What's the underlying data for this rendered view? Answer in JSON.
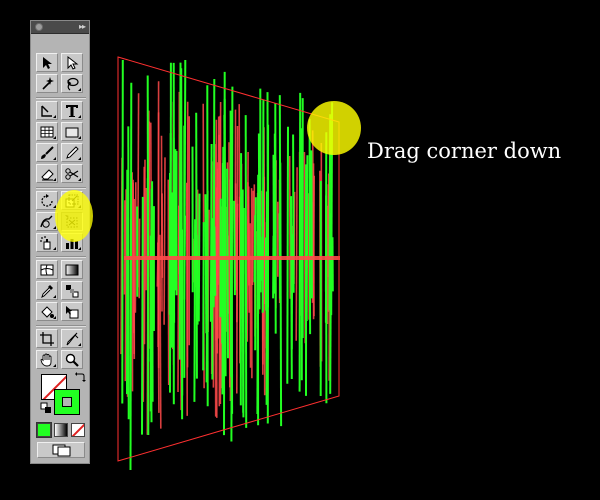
{
  "instruction": {
    "text": "Drag corner down"
  },
  "colors": {
    "background": "#000000",
    "stroke_primary": "#22ff22",
    "stroke_secondary": "#ff4a4a",
    "bounding_box": "#ff3030",
    "highlight": "#ffff00",
    "fill_indicator": "#ffffff",
    "stroke_indicator": "#22ff22"
  },
  "toolbar": {
    "tools": [
      {
        "name": "selection-tool-icon"
      },
      {
        "name": "direct-selection-tool-icon"
      },
      {
        "name": "magic-wand-tool-icon"
      },
      {
        "name": "lasso-tool-icon"
      },
      {
        "name": "pen-tool-icon"
      },
      {
        "name": "type-tool-icon"
      },
      {
        "name": "line-segment-tool-icon"
      },
      {
        "name": "rectangle-tool-icon"
      },
      {
        "name": "paintbrush-tool-icon"
      },
      {
        "name": "pencil-tool-icon"
      },
      {
        "name": "eraser-tool-icon"
      },
      {
        "name": "scissors-tool-icon"
      },
      {
        "name": "rotate-tool-icon"
      },
      {
        "name": "scale-tool-icon"
      },
      {
        "name": "warp-tool-icon"
      },
      {
        "name": "free-transform-tool-icon"
      },
      {
        "name": "symbol-sprayer-tool-icon"
      },
      {
        "name": "column-graph-tool-icon"
      },
      {
        "name": "mesh-tool-icon"
      },
      {
        "name": "gradient-tool-icon"
      },
      {
        "name": "eyedropper-tool-icon"
      },
      {
        "name": "blend-tool-icon"
      },
      {
        "name": "live-paint-bucket-tool-icon"
      },
      {
        "name": "live-paint-selection-tool-icon"
      },
      {
        "name": "crop-area-tool-icon"
      },
      {
        "name": "slice-tool-icon"
      },
      {
        "name": "hand-tool-icon"
      },
      {
        "name": "zoom-tool-icon"
      }
    ],
    "active_tool": "free-transform-tool-icon"
  }
}
